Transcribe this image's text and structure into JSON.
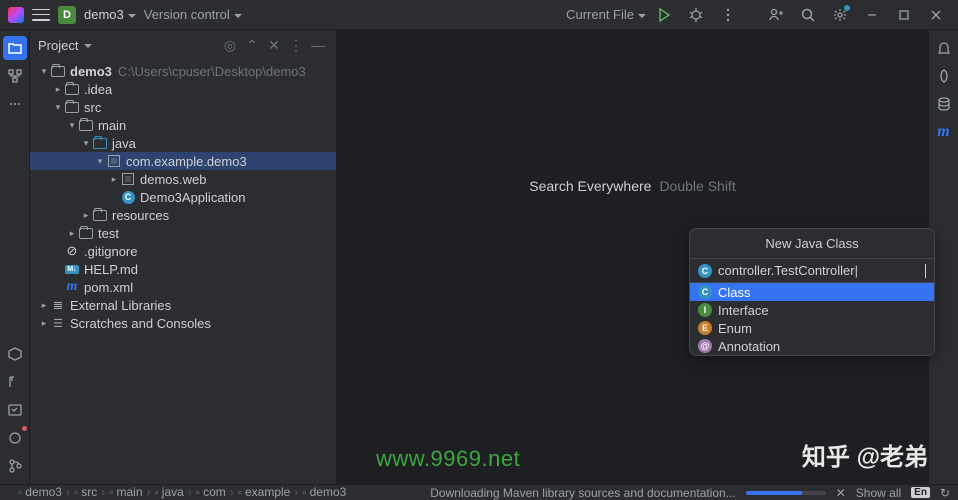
{
  "titlebar": {
    "project_initial": "D",
    "project_name": "demo3",
    "vcs_label": "Version control",
    "run_config": "Current File"
  },
  "project_tool": {
    "title": "Project"
  },
  "tree": {
    "root": {
      "name": "demo3",
      "path": "C:\\Users\\cpuser\\Desktop\\demo3"
    },
    "idea": ".idea",
    "src": "src",
    "main": "main",
    "java": "java",
    "pkg_selected": "com.example.demo3",
    "pkg_web": "demos.web",
    "app_class": "Demo3Application",
    "resources": "resources",
    "test": "test",
    "gitignore": ".gitignore",
    "help": "HELP.md",
    "pom": "pom.xml",
    "ext_lib": "External Libraries",
    "scratches": "Scratches and Consoles"
  },
  "editor_hint": {
    "label": "Search Everywhere",
    "shortcut": "Double Shift"
  },
  "popup": {
    "title": "New Java Class",
    "input_value": "controller.TestController",
    "options": [
      {
        "icon": "C",
        "cls": "c",
        "label": "Class",
        "selected": true
      },
      {
        "icon": "I",
        "cls": "i",
        "label": "Interface",
        "selected": false
      },
      {
        "icon": "E",
        "cls": "e",
        "label": "Enum",
        "selected": false
      },
      {
        "icon": "@",
        "cls": "a",
        "label": "Annotation",
        "selected": false
      }
    ]
  },
  "breadcrumb": {
    "items": [
      "demo3",
      "src",
      "main",
      "java",
      "com",
      "example",
      "demo3"
    ]
  },
  "status": {
    "message": "Downloading Maven library sources and documentation...",
    "show_all": "Show all",
    "lang": "En"
  },
  "watermarks": {
    "url": "www.9969.net",
    "zhihu": "知乎 @老弟"
  }
}
